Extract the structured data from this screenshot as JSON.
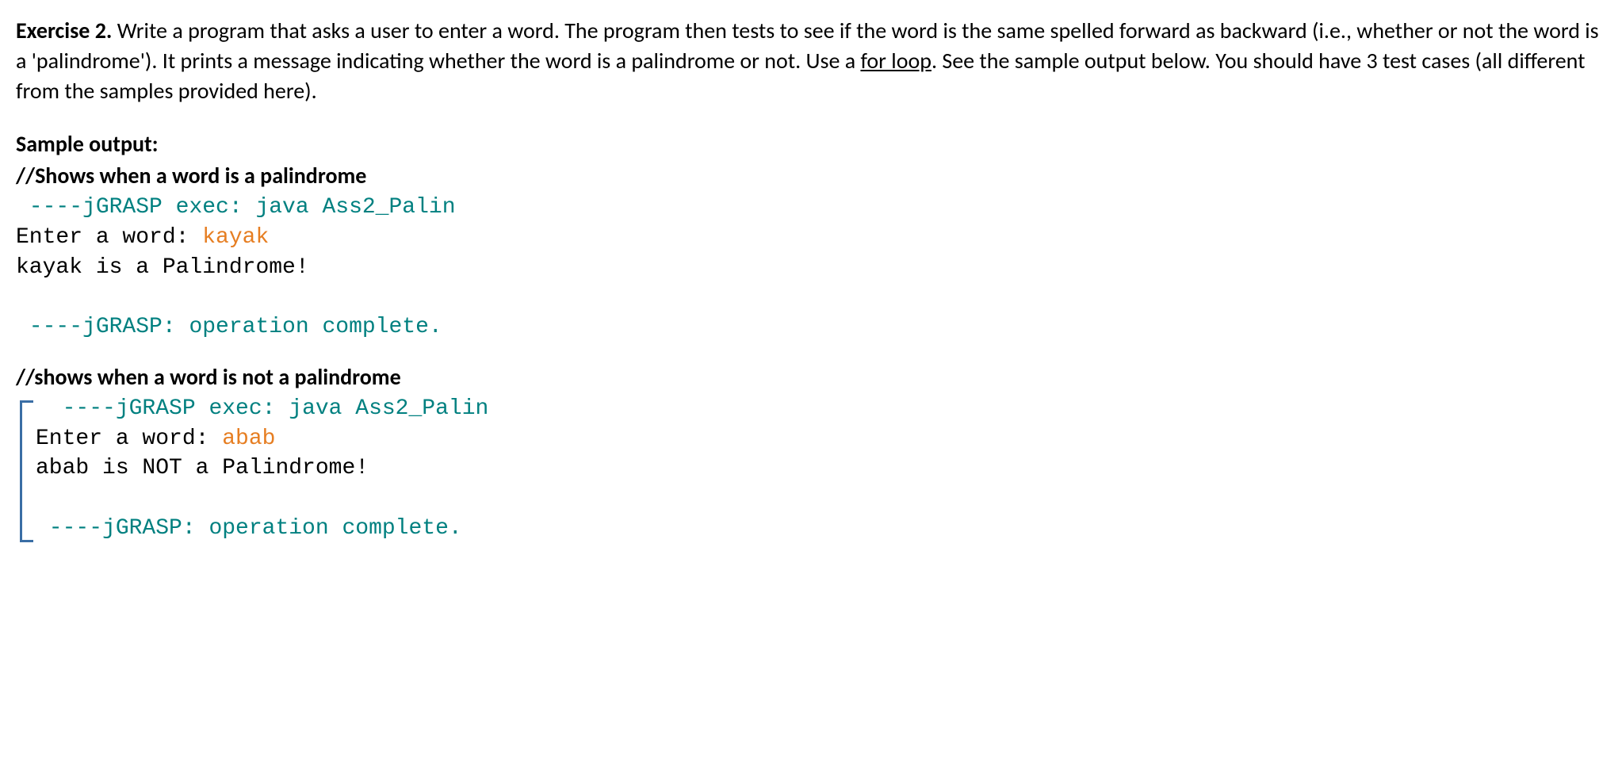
{
  "exercise": {
    "title": "Exercise 2.",
    "body_part1": " Write a program that asks a user to enter a word. The program then tests to see if the word is the same spelled forward as backward (i.e., whether or not the word is a 'palindrome'). It prints a message indicating whether the word is a palindrome or not. Use a ",
    "body_linked": "for loop",
    "body_part2": ". See the sample output below. You should have 3 test cases (all different from the samples provided here)."
  },
  "sample": {
    "heading": "Sample output:",
    "case1": {
      "comment": "//Shows when a word is a palindrome",
      "exec_prefix": " ----",
      "exec_text": "jGRASP exec: java Ass2_Palin",
      "prompt": "Enter a word: ",
      "input": "kayak",
      "result": "kayak is a Palindrome!",
      "complete_prefix": " ----",
      "complete_text": "jGRASP: operation complete."
    },
    "case2": {
      "comment": "//shows when a word is not a palindrome",
      "exec_prefix": "  ----",
      "exec_text": "jGRASP exec: java Ass2_Palin",
      "prompt": "Enter a word: ",
      "input": "abab",
      "result": "abab is NOT a Palindrome!",
      "complete_prefix": " ----",
      "complete_text": "jGRASP: operation complete."
    }
  }
}
